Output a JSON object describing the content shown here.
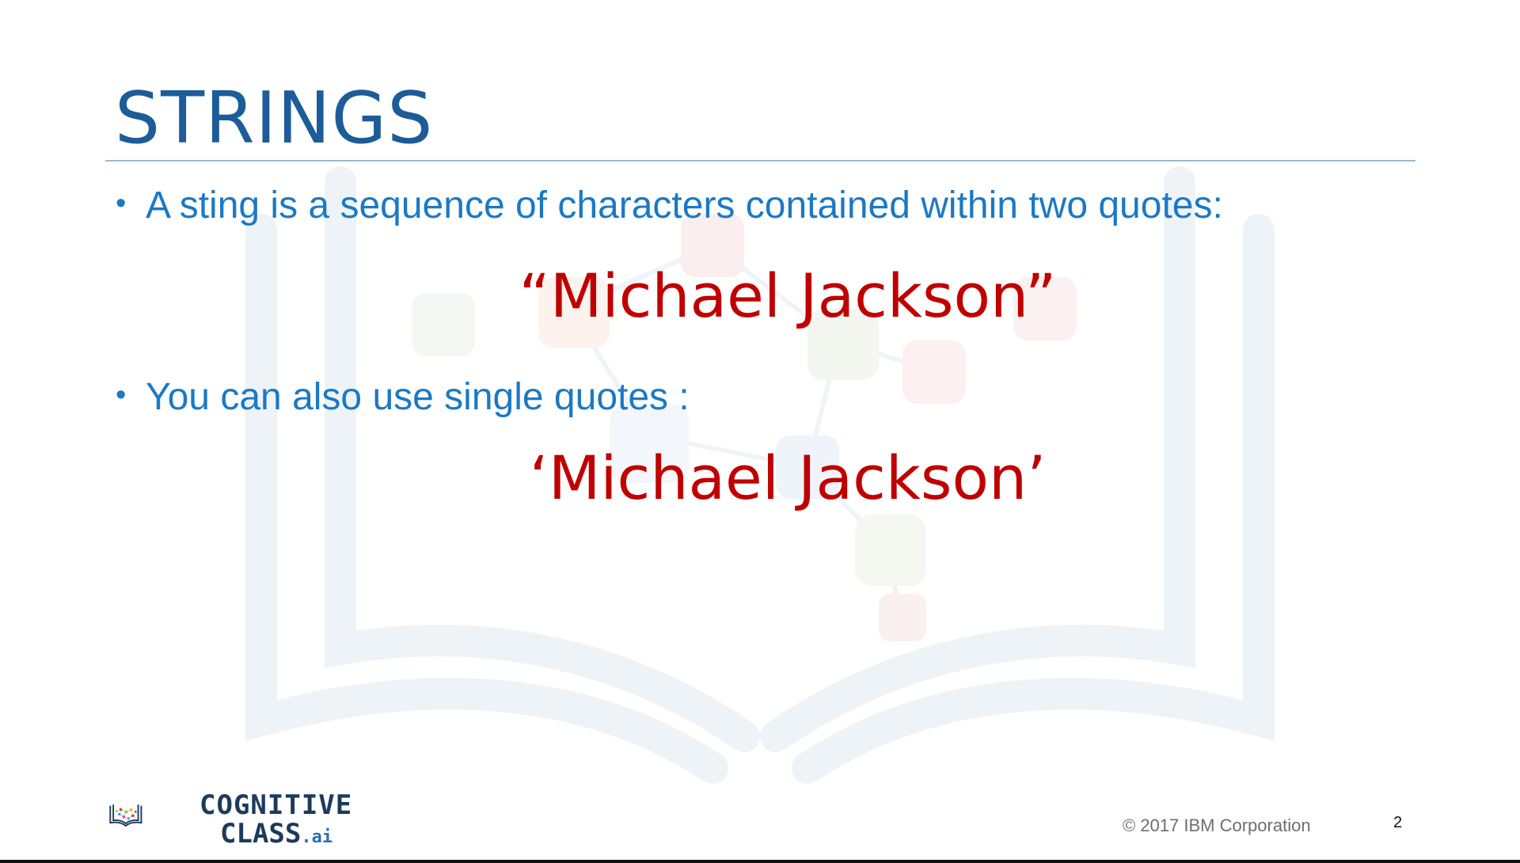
{
  "slide": {
    "title": "STRINGS",
    "bullets": [
      {
        "text": "A sting is a sequence of characters contained within two quotes:",
        "example": "“Michael Jackson”"
      },
      {
        "text": "You can also use single quotes :",
        "example": "‘Michael Jackson’"
      }
    ],
    "bullet_glyph": "•"
  },
  "footer": {
    "logo": {
      "line1": "COGNITIVE",
      "line2": "CLASS",
      "suffix": ".ai"
    },
    "copyright": "© 2017 IBM Corporation",
    "page_number": "2"
  },
  "colors": {
    "title": "#1c5c98",
    "bullet_text": "#1b79c4",
    "example_text": "#c00000",
    "logo_text": "#1d3a5c"
  }
}
